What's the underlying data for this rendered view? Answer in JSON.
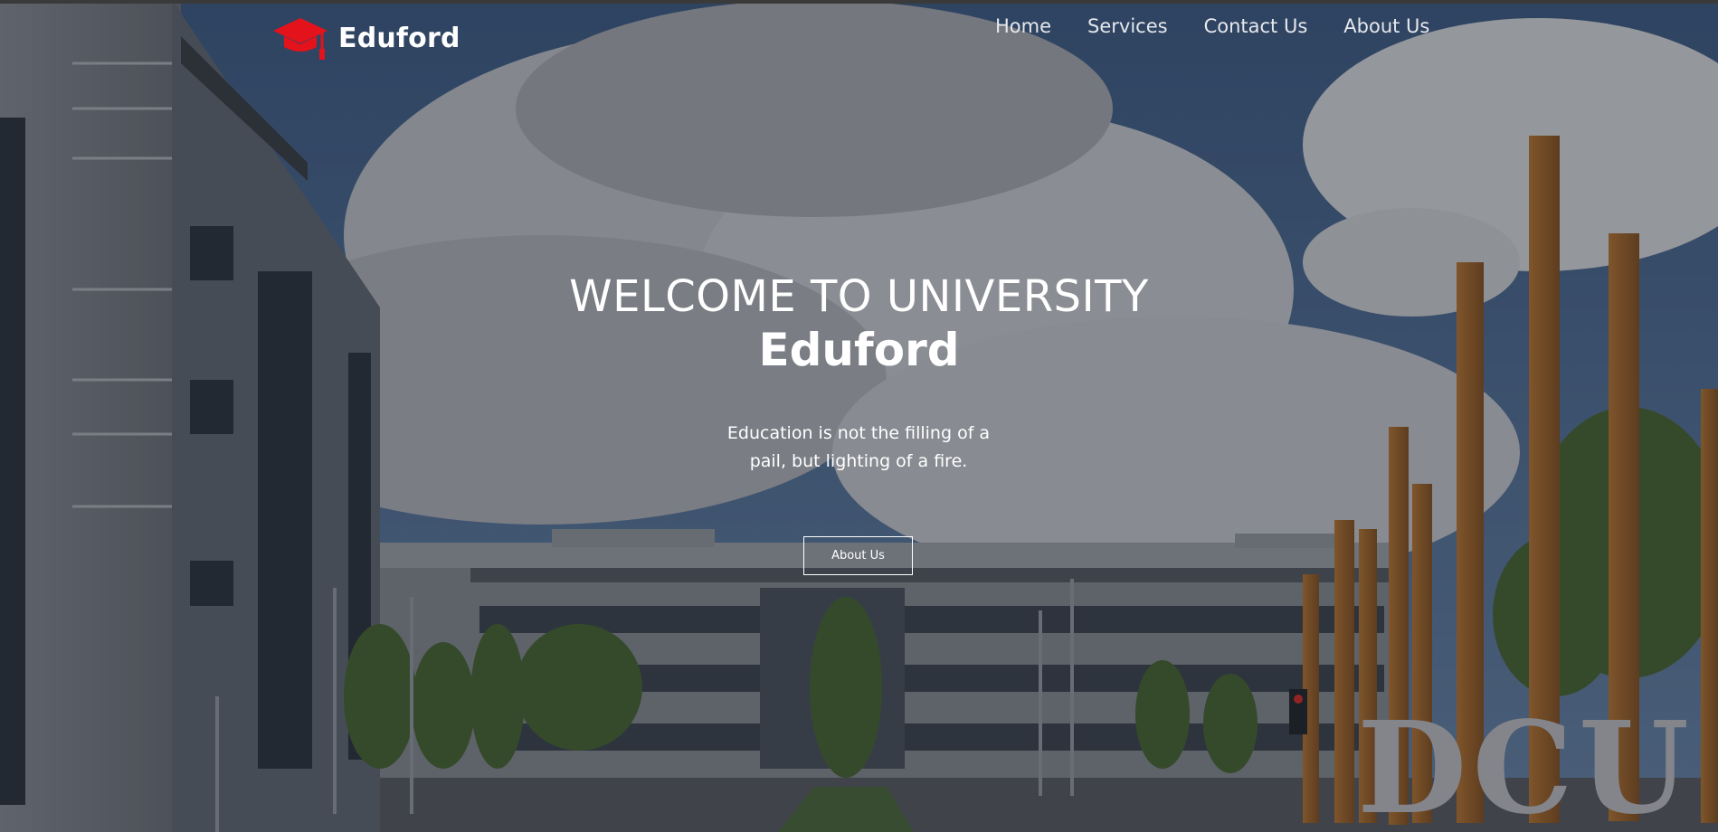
{
  "brand": {
    "name": "Eduford",
    "logo_icon": "graduation-cap-icon",
    "logo_color": "#e3121b"
  },
  "nav": {
    "items": [
      {
        "label": "Home"
      },
      {
        "label": "Services"
      },
      {
        "label": "Contact Us"
      },
      {
        "label": "About Us"
      }
    ]
  },
  "hero": {
    "title": "WELCOME TO UNIVERSITY",
    "subtitle": "Eduford",
    "tagline_line1": "Education is not the filling of a",
    "tagline_line2": "pail, but lighting of a fire.",
    "cta_label": "About Us",
    "background_sign": "DCU"
  },
  "colors": {
    "text": "#ffffff",
    "nav_text": "#e6e8ec",
    "sky": "#3e5f8a",
    "pillar": "#a86a2b"
  }
}
